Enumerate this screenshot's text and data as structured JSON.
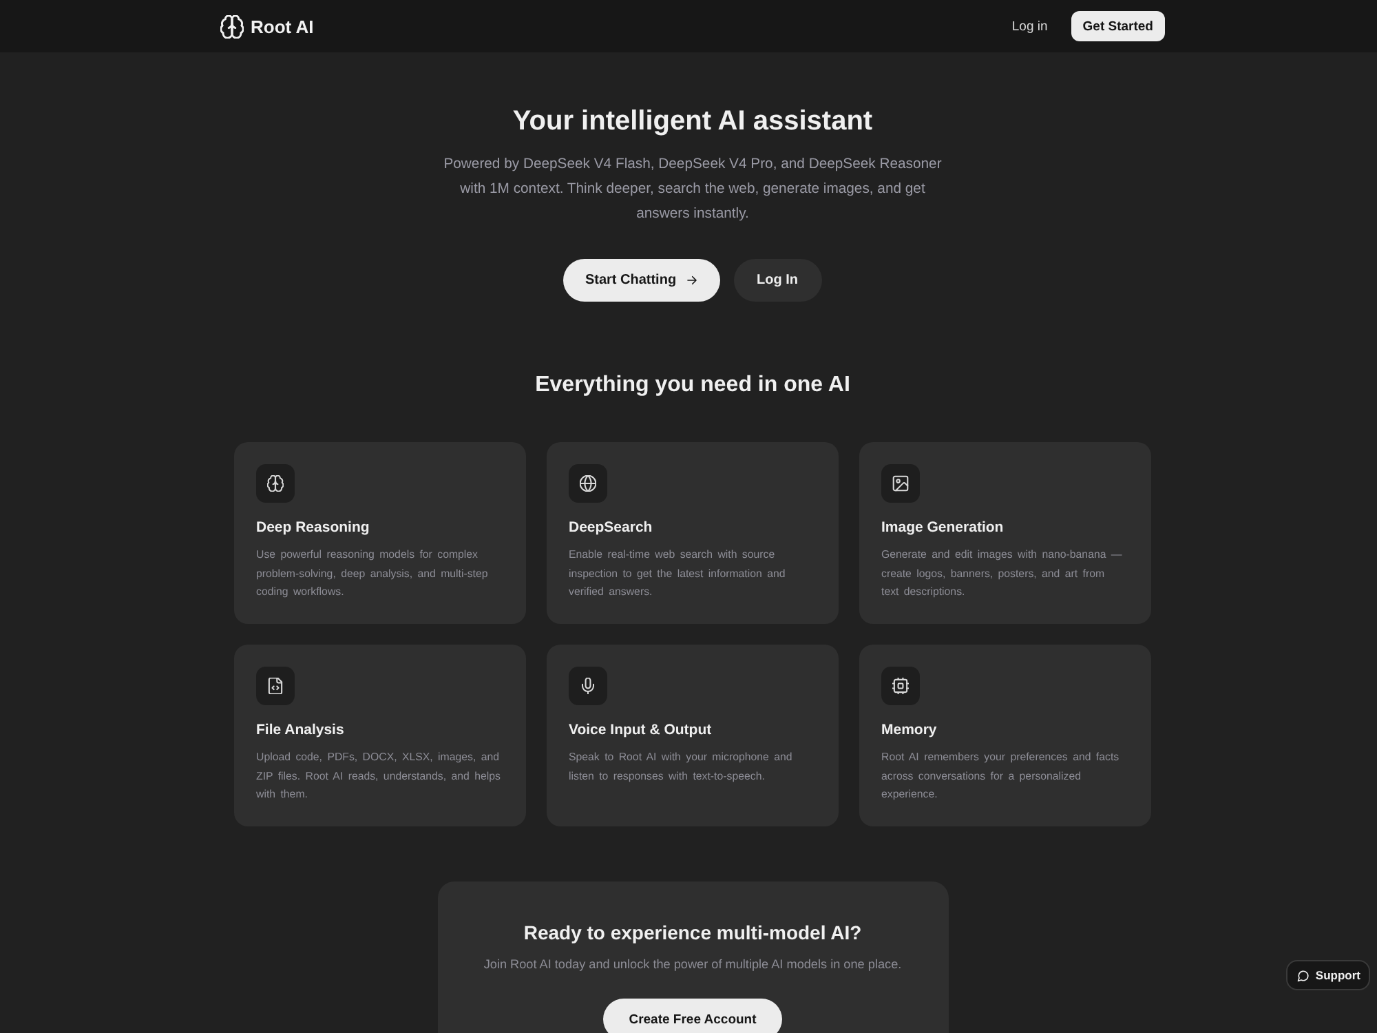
{
  "nav": {
    "brand": "Root AI",
    "links": [
      {
        "label": "Log in",
        "kind": "link"
      },
      {
        "label": "Get Started",
        "kind": "button"
      }
    ]
  },
  "hero": {
    "title": "Your intelligent AI assistant",
    "subtitle": "Powered by DeepSeek V4 Flash, DeepSeek V4 Pro, and DeepSeek Reasoner with 1M context. Think deeper, search the web, generate images, and get answers instantly.",
    "buttons": [
      {
        "label": "Start Chatting",
        "kind": "primary"
      },
      {
        "label": "Log In",
        "kind": "secondary"
      }
    ]
  },
  "features": {
    "title": "Everything you need in one AI",
    "cards": [
      {
        "title": "Deep Reasoning",
        "text": "Use powerful reasoning models for complex problem-solving, deep analysis, and multi-step coding workflows."
      },
      {
        "title": "DeepSearch",
        "text": "Enable real-time web search with source inspection to get the latest information and verified answers."
      },
      {
        "title": "Image Generation",
        "text": "Generate and edit images with nano-banana — create logos, banners, posters, and art from text descriptions."
      },
      {
        "title": "File Analysis",
        "text": "Upload code, PDFs, DOCX, XLSX, images, and ZIP files. Root AI reads, understands, and helps with them."
      },
      {
        "title": "Voice Input & Output",
        "text": "Speak to Root AI with your microphone and listen to responses with text-to-speech."
      },
      {
        "title": "Memory",
        "text": "Root AI remembers your preferences and facts across conversations for a personalized experience."
      }
    ]
  },
  "cta": {
    "title": "Ready to experience multi-model AI?",
    "text": "Join Root AI today and unlock the power of multiple AI models in one place.",
    "button": "Create Free Account"
  },
  "support": {
    "label": "Support"
  }
}
